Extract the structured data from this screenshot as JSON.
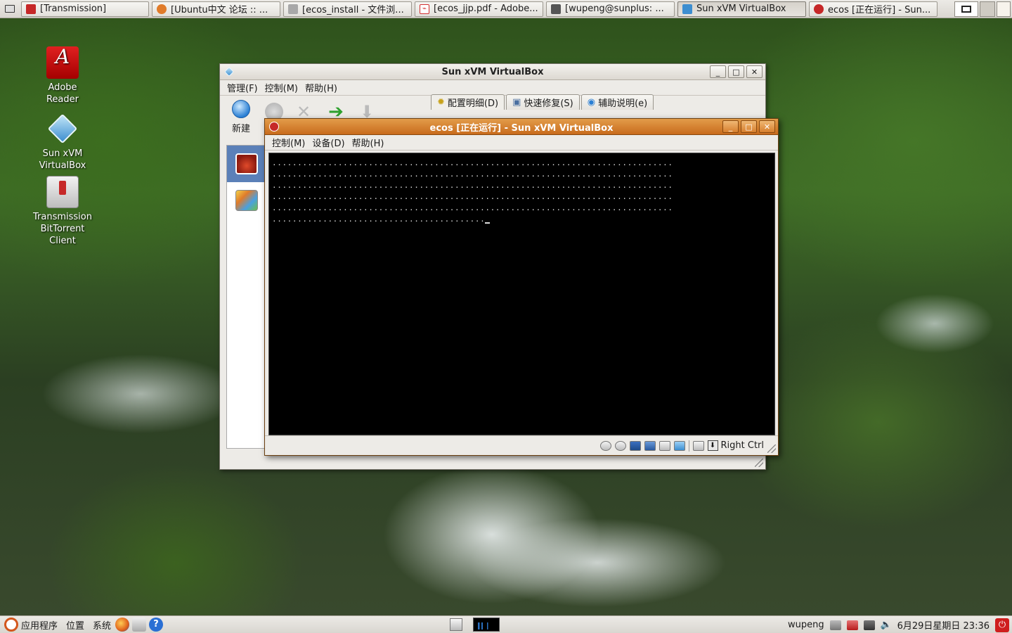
{
  "taskbar": {
    "tasks": [
      {
        "label": "[Transmission]",
        "icon": "transmission-icon",
        "color": "#c62828"
      },
      {
        "label": "[Ubuntu中文 论坛 :: ...",
        "icon": "firefox-icon",
        "color": "#e07b2a"
      },
      {
        "label": "[ecos_install - 文件浏...",
        "icon": "folder-icon",
        "color": "#8a8a8a"
      },
      {
        "label": "[ecos_jjp.pdf - Adobe...",
        "icon": "pdf-icon",
        "color": "#d32f2f"
      },
      {
        "label": "[wupeng@sunplus: ...",
        "icon": "terminal-icon",
        "color": "#555555"
      },
      {
        "label": "Sun xVM VirtualBox",
        "icon": "virtualbox-icon",
        "color": "#3d8ed0"
      },
      {
        "label": "ecos [正在运行] - Sun...",
        "icon": "vm-redhat-icon",
        "color": "#c62828"
      }
    ]
  },
  "desktop": {
    "icons": [
      {
        "label": "Adobe Reader"
      },
      {
        "label": "Sun xVM VirtualBox"
      },
      {
        "label": "Transmission BitTorrent Client"
      }
    ]
  },
  "main_window": {
    "title": "Sun xVM VirtualBox",
    "menu": [
      "管理(F)",
      "控制(M)",
      "帮助(H)"
    ],
    "toolbar_new": "新建",
    "tabs": [
      "配置明细(D)",
      "快速修复(S)",
      "辅助说明(e)"
    ]
  },
  "vm_window": {
    "title": "ecos [正在运行] - Sun xVM VirtualBox",
    "menu": [
      "控制(M)",
      "设备(D)",
      "帮助(H)"
    ],
    "screen_lines": [
      "...............................................................................",
      "...............................................................................",
      "...............................................................................",
      "...............................................................................",
      "...............................................................................",
      ".........................................."
    ],
    "host_key": "Right Ctrl"
  },
  "bottom_panel": {
    "applications": "应用程序",
    "places": "位置",
    "system": "系统",
    "user": "wupeng",
    "datetime": "6月29日星期日  23:36"
  },
  "colors": {
    "vm_titlebar": "#d77f2e",
    "selection": "#5b80b8"
  }
}
